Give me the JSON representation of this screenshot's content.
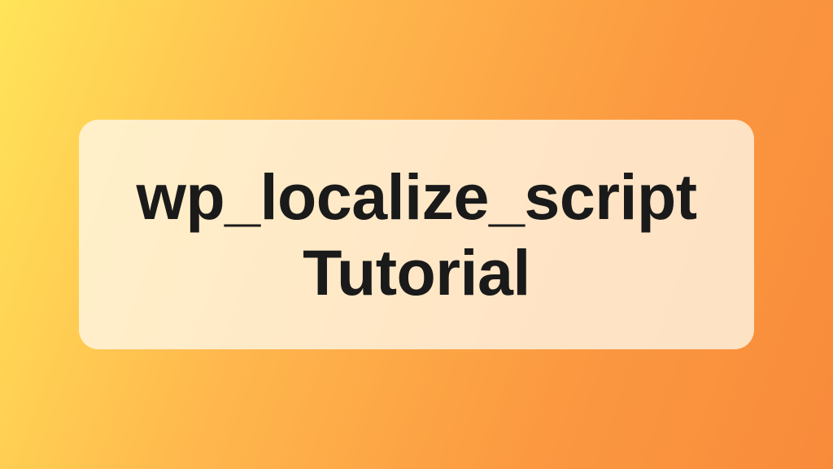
{
  "hero": {
    "title": "wp_localize_script\nTutorial"
  }
}
